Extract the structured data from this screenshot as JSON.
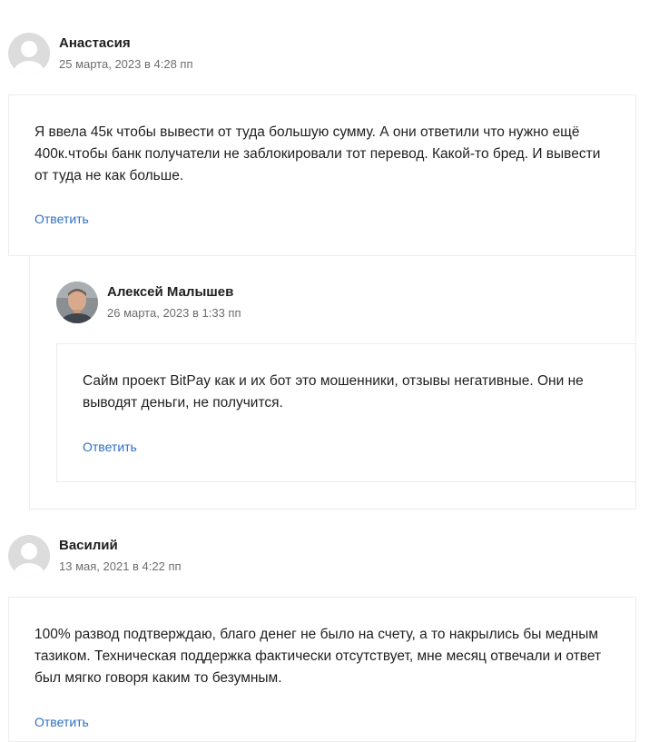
{
  "comments": [
    {
      "author": "Анастасия",
      "date": "25 марта, 2023 в 4:28 пп",
      "text": "Я ввела 45к чтобы вывести от туда большую сумму. А они ответили что нужно ещё 400к.чтобы банк получатели не заблокировали тот перевод. Какой-то бред. И вывести от туда не как больше.",
      "reply_label": "Ответить",
      "avatar": "default-avatar-icon"
    },
    {
      "author": "Алексей Малышев",
      "date": "26 марта, 2023 в 1:33 пп",
      "text": "Сайм проект BitPay как и их бот это мошенники, отзывы негативные. Они не выводят деньги, не получится.",
      "reply_label": "Ответить",
      "avatar": "user-photo"
    },
    {
      "author": "Василий",
      "date": "13 мая, 2021 в 4:22 пп",
      "text": "100% развод подтверждаю, благо денег не было на счету, а то накрылись бы медным тазиком. Техническая поддержка фактически отсутствует, мне месяц отвечали и ответ был мягко говоря каким то безумным.",
      "reply_label": "Ответить",
      "avatar": "default-avatar-icon"
    }
  ],
  "colors": {
    "link": "#2e6fc4",
    "border": "#ececec",
    "date": "#6d6d6d"
  }
}
